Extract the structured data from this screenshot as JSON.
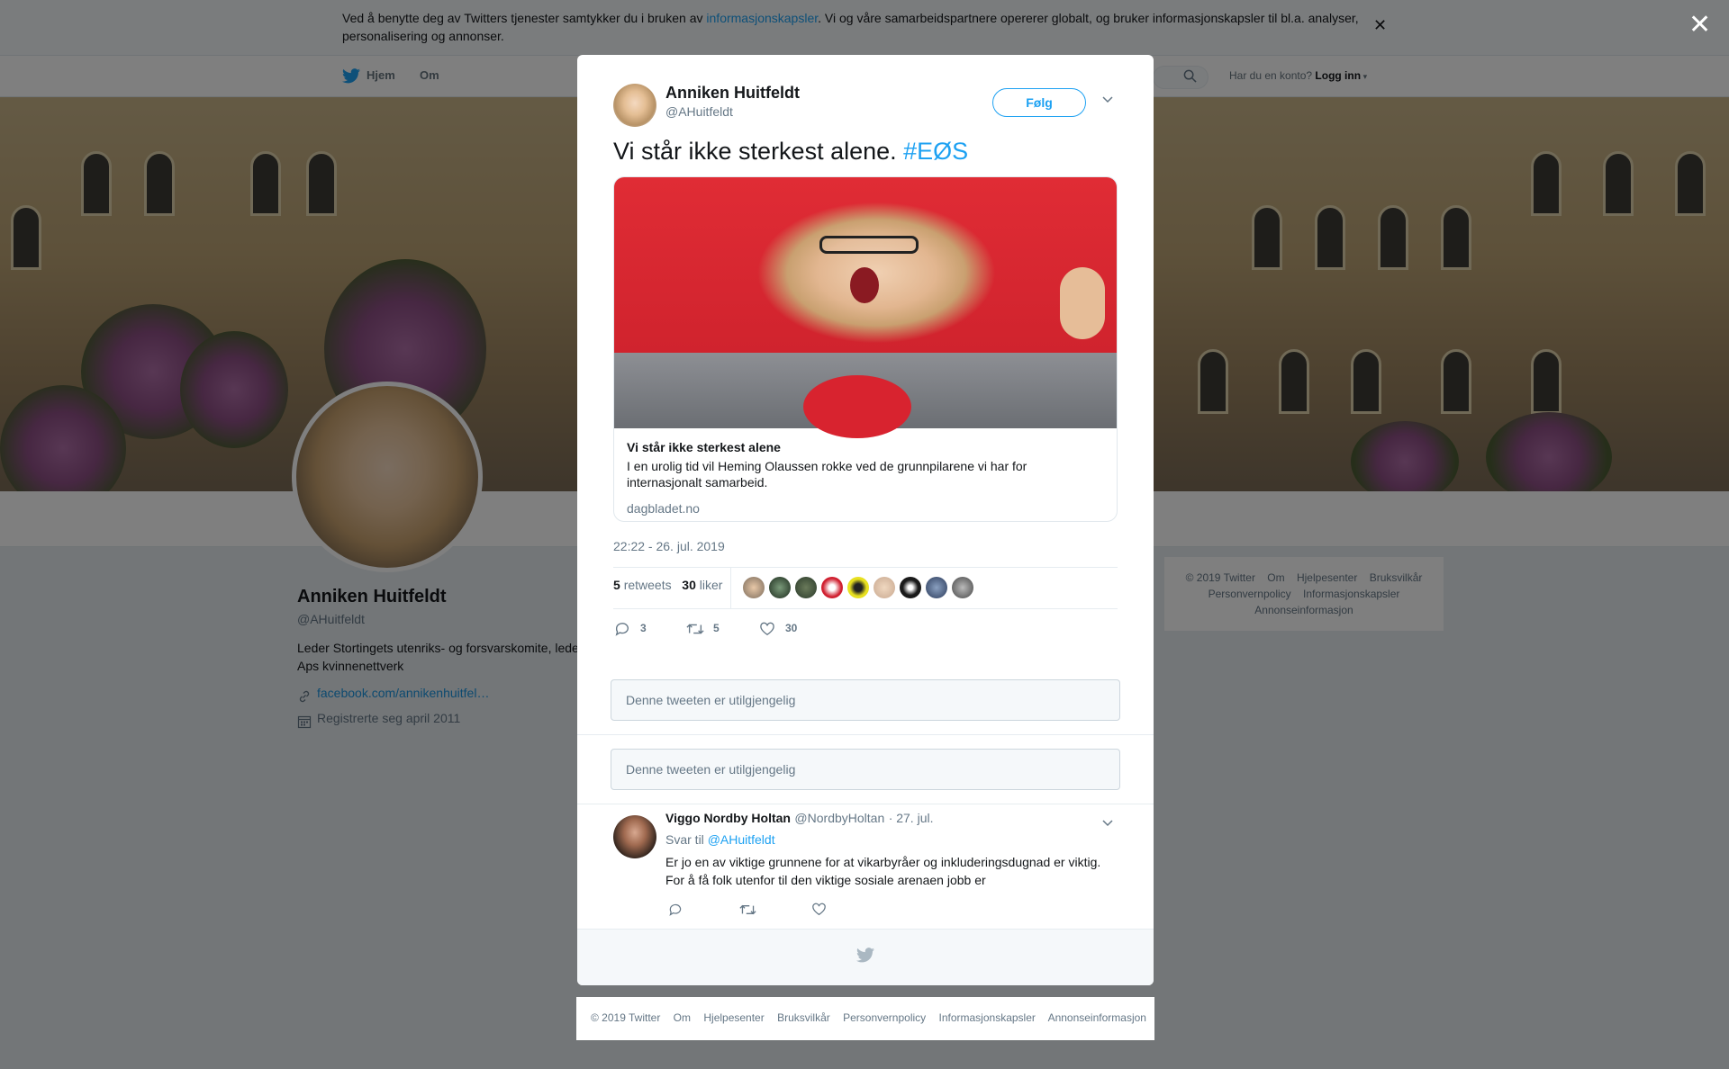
{
  "cookie_bar": {
    "text_before": "Ved å benytte deg av Twitters tjenester samtykker du i bruken av ",
    "link": "informasjonskapsler",
    "text_after": ". Vi og våre samarbeidspartnere opererer globalt, og bruker informasjonskapsler til bl.a. analyser, personalisering og annonser.",
    "close": "✕"
  },
  "nav": {
    "home": "Hjem",
    "about": "Om",
    "have_account": "Har du en konto?",
    "login": "Logg inn"
  },
  "profile": {
    "name": "Anniken Huitfeldt",
    "handle": "@AHuitfeldt",
    "bio": "Leder Stortingets utenriks- og forsvarskomite, leder Aps kvinnenettverk",
    "link": "facebook.com/annikenhuitfel…",
    "joined": "Registrerte seg april 2011"
  },
  "side_footer": {
    "links": [
      "© 2019 Twitter",
      "Om",
      "Hjelpesenter",
      "Bruksvilkår",
      "Personvernpolicy",
      "Informasjonskapsler",
      "Annonseinformasjon"
    ]
  },
  "overlay_close": "✕",
  "tweet": {
    "author_name": "Anniken Huitfeldt",
    "author_handle": "@AHuitfeldt",
    "follow_label": "Følg",
    "text": "Vi står ikke sterkest alene. ",
    "hashtag": "#EØS",
    "card": {
      "title": "Vi står ikke sterkest alene",
      "description": "I en urolig tid vil Heming Olaussen rokke ved de grunnpilarene vi har for internasjonalt samarbeid.",
      "domain": "dagbladet.no"
    },
    "timestamp": "22:22 - 26. jul. 2019",
    "retweets_count": "5",
    "retweets_label": "retweets",
    "likes_count": "30",
    "likes_label": "liker",
    "actions": {
      "replies": "3",
      "retweets": "5",
      "likes": "30"
    }
  },
  "unavailable": [
    "Denne tweeten er utilgjengelig",
    "Denne tweeten er utilgjengelig"
  ],
  "reply": {
    "name": "Viggo Nordby Holtan",
    "handle": "@NordbyHoltan",
    "date": "· 27. jul.",
    "reply_to_label": "Svar til",
    "reply_to_handle": "@AHuitfeldt",
    "text": "Er jo en av viktige grunnene for at vikarbyråer og inkluderingsdugnad er viktig. For å få folk utenfor til den viktige sosiale arenaen jobb er"
  },
  "bottom_footer": {
    "links": [
      "© 2019 Twitter",
      "Om",
      "Hjelpesenter",
      "Bruksvilkår",
      "Personvernpolicy",
      "Informasjonskapsler",
      "Annonseinformasjon"
    ]
  },
  "colors": {
    "accent": "#1da1f2",
    "text": "#14171a",
    "muted": "#657786"
  }
}
